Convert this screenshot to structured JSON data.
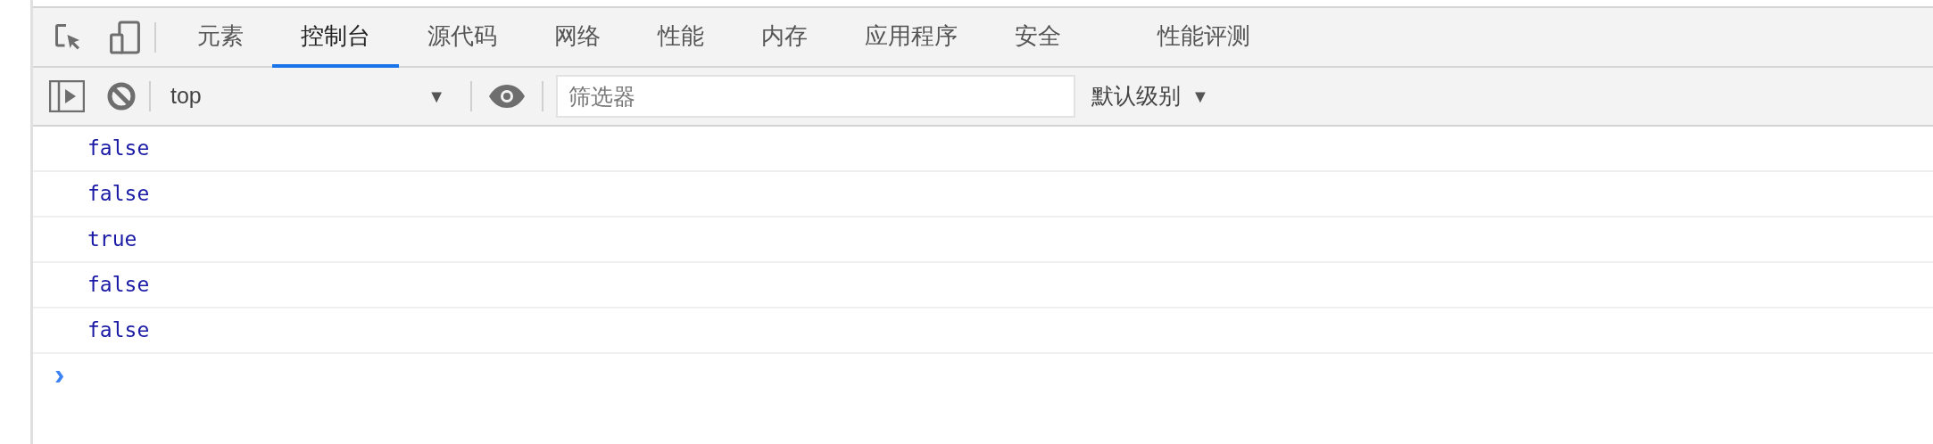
{
  "tabs": [
    {
      "label": "元素",
      "selected": false
    },
    {
      "label": "控制台",
      "selected": true
    },
    {
      "label": "源代码",
      "selected": false
    },
    {
      "label": "网络",
      "selected": false
    },
    {
      "label": "性能",
      "selected": false
    },
    {
      "label": "内存",
      "selected": false
    },
    {
      "label": "应用程序",
      "selected": false
    },
    {
      "label": "安全",
      "selected": false
    },
    {
      "label": "性能评测",
      "selected": false
    }
  ],
  "toolbar": {
    "context": "top",
    "filter": {
      "placeholder": "筛选器"
    },
    "levels": "默认级别",
    "levels_caret": "▼",
    "context_caret": "▼"
  },
  "console": {
    "lines": [
      "false",
      "false",
      "true",
      "false",
      "false"
    ],
    "prompt": "›"
  }
}
